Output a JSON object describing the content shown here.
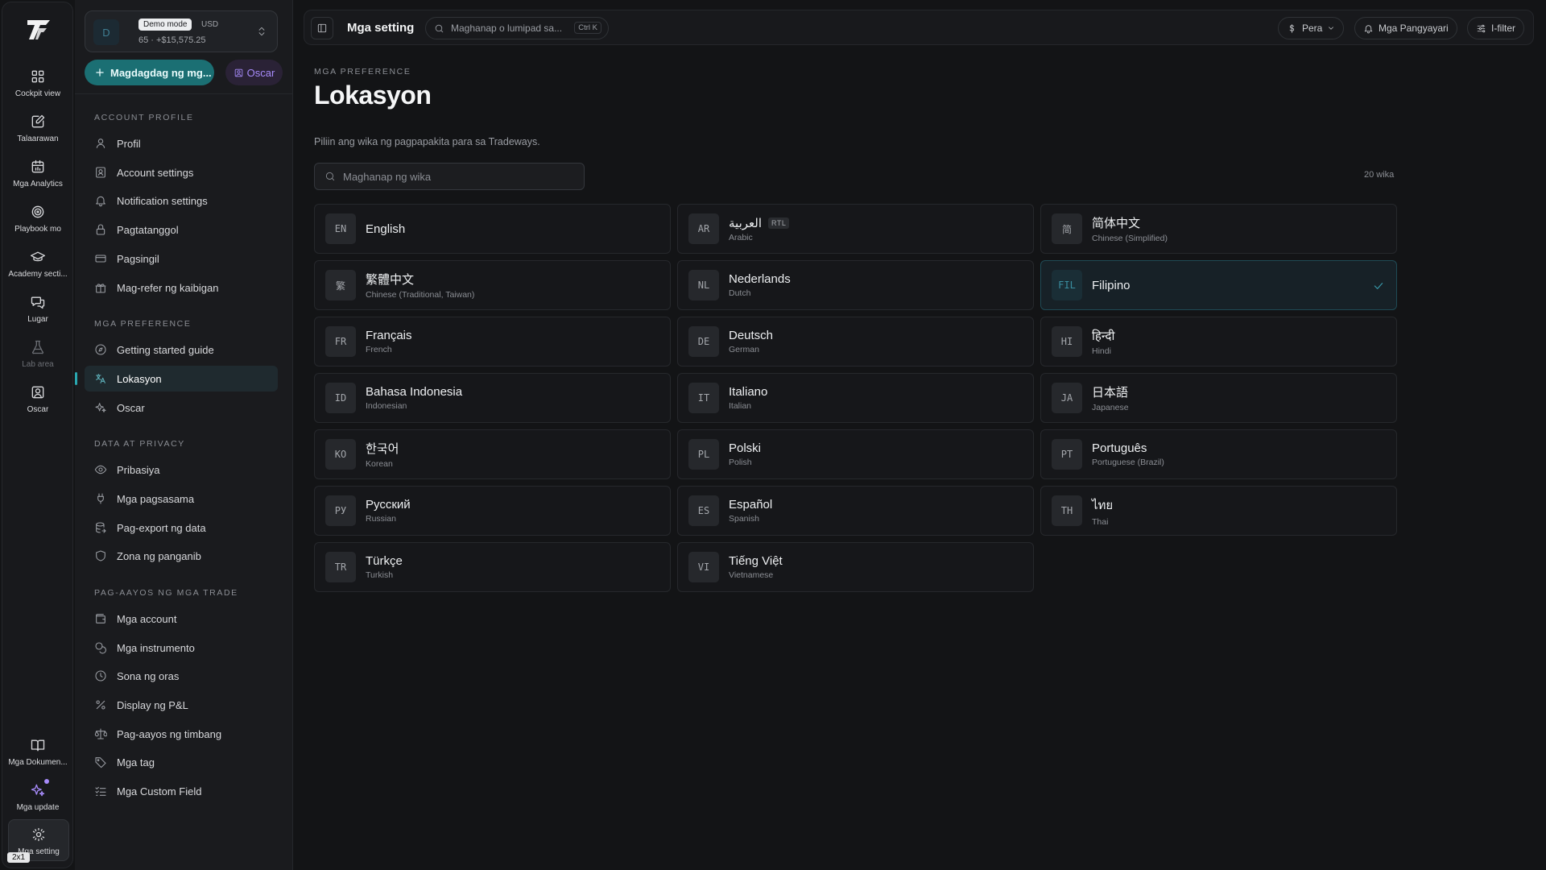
{
  "rail": {
    "items": [
      {
        "label": "Cockpit view",
        "icon": "grid-icon"
      },
      {
        "label": "Talaarawan",
        "icon": "journal-edit-icon"
      },
      {
        "label": "Mga Analytics",
        "icon": "calendar-chart-icon"
      },
      {
        "label": "Playbook mo",
        "icon": "target-icon"
      },
      {
        "label": "Academy secti...",
        "icon": "graduation-cap-icon"
      },
      {
        "label": "Lugar",
        "icon": "chat-bubbles-icon"
      },
      {
        "label": "Lab area",
        "icon": "flask-icon"
      },
      {
        "label": "Oscar",
        "icon": "bot-square-icon"
      }
    ],
    "bottom": [
      {
        "label": "Mga Dokumen...",
        "icon": "book-open-icon"
      },
      {
        "label": "Mga update",
        "icon": "sparkles-icon"
      },
      {
        "label": "Mga setting",
        "icon": "gear-icon"
      }
    ],
    "zoom_badge": "2x1"
  },
  "account": {
    "avatar": "D",
    "mode": "Demo mode",
    "currency": "USD",
    "balance": "65 · +$15,575.25"
  },
  "sidebar": {
    "add_button": "Magdagdag ng mg...",
    "oscar_button": "Oscar",
    "sections": [
      {
        "title": "ACCOUNT PROFILE",
        "items": [
          {
            "label": "Profil",
            "icon": "user-icon"
          },
          {
            "label": "Account settings",
            "icon": "account-settings-icon"
          },
          {
            "label": "Notification settings",
            "icon": "bell-icon"
          },
          {
            "label": "Pagtatanggol",
            "icon": "lock-icon"
          },
          {
            "label": "Pagsingil",
            "icon": "credit-card-icon"
          },
          {
            "label": "Mag-refer ng kaibigan",
            "icon": "gift-icon"
          }
        ]
      },
      {
        "title": "MGA PREFERENCE",
        "items": [
          {
            "label": "Getting started guide",
            "icon": "compass-icon"
          },
          {
            "label": "Lokasyon",
            "icon": "translate-icon",
            "active": true
          },
          {
            "label": "Oscar",
            "icon": "sparkles-icon"
          }
        ]
      },
      {
        "title": "DATA AT PRIVACY",
        "items": [
          {
            "label": "Pribasiya",
            "icon": "eye-icon"
          },
          {
            "label": "Mga pagsasama",
            "icon": "plug-icon"
          },
          {
            "label": "Pag-export ng data",
            "icon": "database-export-icon"
          },
          {
            "label": "Zona ng panganib",
            "icon": "shield-icon"
          }
        ]
      },
      {
        "title": "PAG-AAYOS NG MGA TRADE",
        "items": [
          {
            "label": "Mga account",
            "icon": "wallet-icon"
          },
          {
            "label": "Mga instrumento",
            "icon": "coins-icon"
          },
          {
            "label": "Sona ng oras",
            "icon": "clock-icon"
          },
          {
            "label": "Display ng P&L",
            "icon": "percent-icon"
          },
          {
            "label": "Pag-aayos ng timbang",
            "icon": "scale-icon"
          },
          {
            "label": "Mga tag",
            "icon": "tag-icon"
          },
          {
            "label": "Mga Custom Field",
            "icon": "list-checks-icon"
          }
        ]
      }
    ]
  },
  "topbar": {
    "title": "Mga setting",
    "search_placeholder": "Maghanap o lumipad sa...",
    "search_shortcut": "Ctrl K",
    "currency_button": "Pera",
    "events_button": "Mga Pangyayari",
    "filter_button": "I-filter"
  },
  "main": {
    "eyebrow": "MGA PREFERENCE",
    "title": "Lokasyon",
    "description": "Piliin ang wika ng pagpapakita para sa Tradeways.",
    "search_placeholder": "Maghanap ng wika",
    "count": "20 wika",
    "rtl_badge": "RTL",
    "languages": [
      {
        "code": "EN",
        "native": "English",
        "english": ""
      },
      {
        "code": "AR",
        "native": "العربية",
        "english": "Arabic",
        "rtl": true
      },
      {
        "code": "简",
        "native": "简体中文",
        "english": "Chinese (Simplified)"
      },
      {
        "code": "繁",
        "native": "繁體中文",
        "english": "Chinese (Traditional, Taiwan)"
      },
      {
        "code": "NL",
        "native": "Nederlands",
        "english": "Dutch"
      },
      {
        "code": "FIL",
        "native": "Filipino",
        "english": "",
        "selected": true
      },
      {
        "code": "FR",
        "native": "Français",
        "english": "French"
      },
      {
        "code": "DE",
        "native": "Deutsch",
        "english": "German"
      },
      {
        "code": "HI",
        "native": "हिन्दी",
        "english": "Hindi"
      },
      {
        "code": "ID",
        "native": "Bahasa Indonesia",
        "english": "Indonesian"
      },
      {
        "code": "IT",
        "native": "Italiano",
        "english": "Italian"
      },
      {
        "code": "JA",
        "native": "日本語",
        "english": "Japanese"
      },
      {
        "code": "KO",
        "native": "한국어",
        "english": "Korean"
      },
      {
        "code": "PL",
        "native": "Polski",
        "english": "Polish"
      },
      {
        "code": "PT",
        "native": "Português",
        "english": "Portuguese (Brazil)"
      },
      {
        "code": "РУ",
        "native": "Русский",
        "english": "Russian"
      },
      {
        "code": "ES",
        "native": "Español",
        "english": "Spanish"
      },
      {
        "code": "TH",
        "native": "ไทย",
        "english": "Thai"
      },
      {
        "code": "TR",
        "native": "Türkçe",
        "english": "Turkish"
      },
      {
        "code": "VI",
        "native": "Tiếng Việt",
        "english": "Vietnamese"
      }
    ]
  },
  "colors": {
    "background": "#131416",
    "accent": "#1b6f73",
    "accent_check": "#3a9fb0",
    "oscar_purple": "#a78bfa"
  }
}
